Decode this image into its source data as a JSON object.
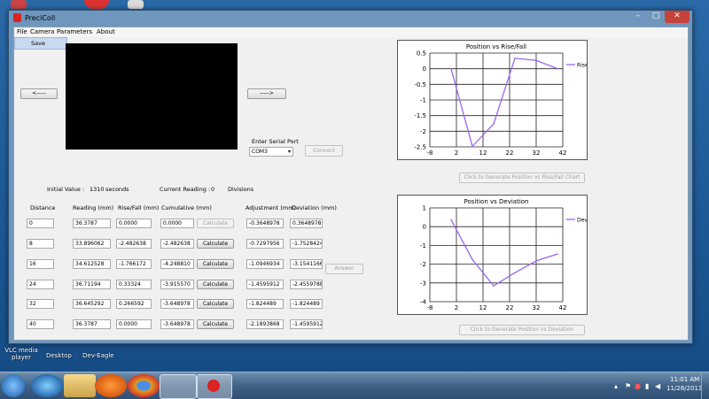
{
  "window": {
    "title": "PreciColl"
  },
  "menu": [
    "File",
    "Camera",
    "Parameters",
    "About"
  ],
  "file_menu": {
    "save": "Save"
  },
  "nav": {
    "left_arrow": "<-----",
    "right_arrow": "----->"
  },
  "serial": {
    "label": "Enter Serial Port",
    "value": "COM3",
    "connect": "Connect"
  },
  "readings": {
    "initial_label": "Initial Value :",
    "initial_value": "1310",
    "initial_unit": "seconds",
    "current_label": "Current Reading :",
    "current_value": "0",
    "current_unit": "Divisions"
  },
  "table": {
    "headers": {
      "distance": "Distance",
      "reading": "Reading (mm)",
      "risefall": "Rise/Fall (mm)",
      "cumulative": "Cumulative (mm)",
      "adjustment": "Adjustment (mm)",
      "deviation": "Deviation (mm)"
    },
    "calc_label": "Calculate",
    "rows": [
      {
        "distance": "0",
        "reading": "36.3787",
        "risefall": "0.0000",
        "cumulative": "0.0000",
        "adjustment": "-0.3648978",
        "deviation": "0.3648978"
      },
      {
        "distance": "8",
        "reading": "33.896062",
        "risefall": "-2.482638",
        "cumulative": "-2.482638",
        "adjustment": "-0.7297956",
        "deviation": "-1.7528424"
      },
      {
        "distance": "16",
        "reading": "34.612528",
        "risefall": "-1.766172",
        "cumulative": "-4.248810",
        "adjustment": "-1.0946934",
        "deviation": "-3.1541166"
      },
      {
        "distance": "24",
        "reading": "36.71194",
        "risefall": "0.33324",
        "cumulative": "-3.915570",
        "adjustment": "-1.4595912",
        "deviation": "-2.4559788"
      },
      {
        "distance": "32",
        "reading": "36.645292",
        "risefall": "0.266592",
        "cumulative": "-3.648978",
        "adjustment": "-1.824489",
        "deviation": "-1.824489"
      },
      {
        "distance": "40",
        "reading": "36.3787",
        "risefall": "0.0000",
        "cumulative": "-3.648978",
        "adjustment": "-2.1893868",
        "deviation": "-1.4595912"
      }
    ],
    "answer": "Answer"
  },
  "buttons": {
    "gen_rise": "Click to Generate Position vs Rise/Fall Chart",
    "gen_dev": "Click to Generate Position vs Deviation"
  },
  "desktop": {
    "icons": [
      "VLC media player",
      "Desktop",
      "Dev-Eagle"
    ]
  },
  "taskbar": {
    "time": "11:01 AM",
    "date": "11/28/2013"
  },
  "chart_data": [
    {
      "type": "line",
      "title": "Position vs Rise/Fall",
      "series": [
        {
          "name": "Rise/Fall",
          "color": "#9966ee",
          "x": [
            0,
            8,
            16,
            24,
            32,
            40
          ],
          "y": [
            0,
            -2.482638,
            -1.766172,
            0.33324,
            0.266592,
            0
          ]
        }
      ],
      "xticks": [
        -8,
        2,
        12,
        22,
        32,
        42
      ],
      "yticks": [
        0.5,
        0,
        -0.5,
        -1,
        -1.5,
        -2,
        -2.5
      ],
      "xlim": [
        -8,
        42
      ],
      "ylim": [
        -2.5,
        0.5
      ],
      "grid": true,
      "legend": "right"
    },
    {
      "type": "line",
      "title": "Position vs Deviation",
      "series": [
        {
          "name": "Deviation",
          "color": "#9966ee",
          "x": [
            0,
            8,
            16,
            24,
            32,
            40
          ],
          "y": [
            0.3648978,
            -1.7528424,
            -3.1541166,
            -2.4559788,
            -1.824489,
            -1.4595912
          ]
        }
      ],
      "xticks": [
        -8,
        2,
        12,
        22,
        32,
        42
      ],
      "yticks": [
        1,
        0,
        -1,
        -2,
        -3,
        -4
      ],
      "xlim": [
        -8,
        42
      ],
      "ylim": [
        -4,
        1
      ],
      "grid": true,
      "legend": "right"
    }
  ]
}
